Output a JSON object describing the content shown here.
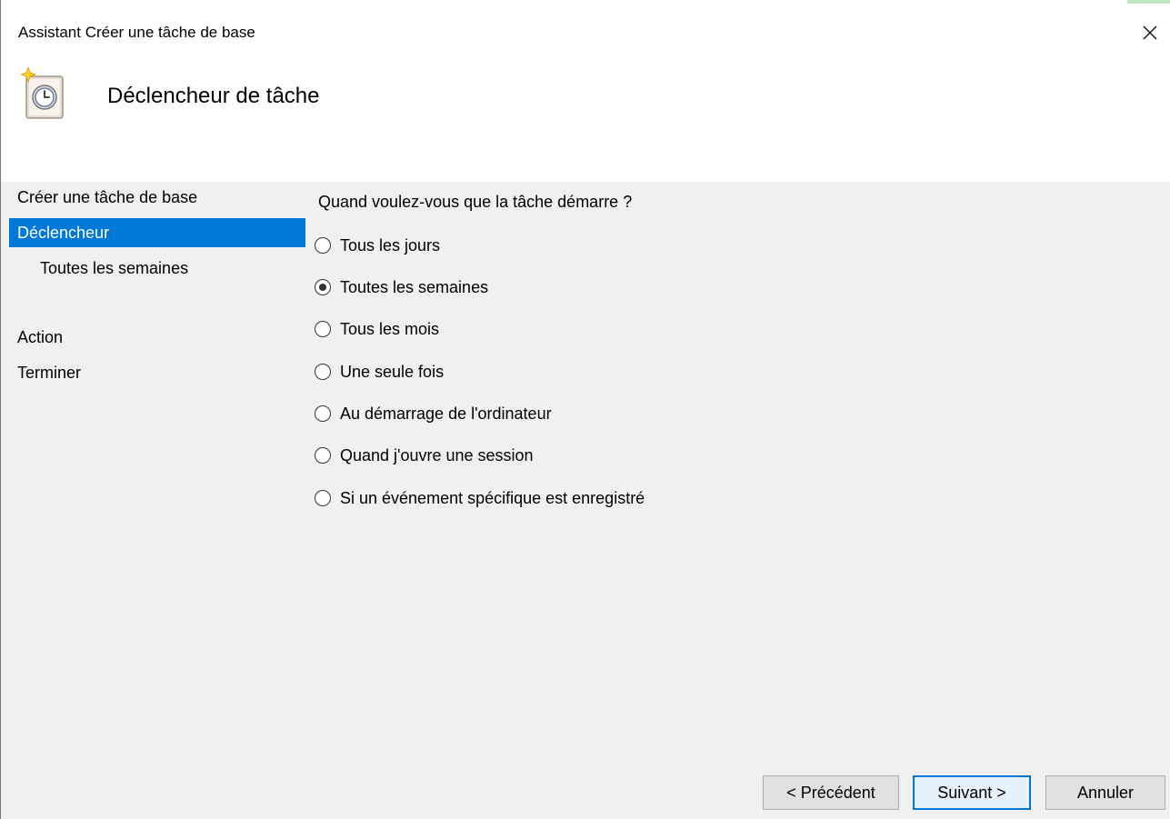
{
  "window": {
    "title": "Assistant Créer une tâche de base",
    "close_glyph": "✕",
    "page_title": "Déclencheur de tâche",
    "icon": "scheduled-task-clock-icon"
  },
  "nav": {
    "items": [
      {
        "label": "Créer une tâche de base",
        "active": false
      },
      {
        "label": "Déclencheur",
        "active": true
      },
      {
        "label": "Toutes les semaines",
        "active": false
      },
      {
        "label": "Action",
        "active": false
      },
      {
        "label": "Terminer",
        "active": false
      }
    ]
  },
  "trigger": {
    "question": "Quand voulez-vous que la tâche démarre ?",
    "options": [
      {
        "label": "Tous les jours",
        "selected": false
      },
      {
        "label": "Toutes les semaines",
        "selected": true
      },
      {
        "label": "Tous les mois",
        "selected": false
      },
      {
        "label": "Une seule fois",
        "selected": false
      },
      {
        "label": "Au démarrage de l'ordinateur",
        "selected": false
      },
      {
        "label": "Quand j'ouvre une session",
        "selected": false
      },
      {
        "label": "Si un événement spécifique est enregistré",
        "selected": false
      }
    ]
  },
  "buttons": {
    "back": "< Précédent",
    "next": "Suivant >",
    "cancel": "Annuler"
  },
  "colors": {
    "accent": "#0078d7",
    "dialog_bg": "#f0f0f0",
    "header_bg": "#ffffff"
  }
}
